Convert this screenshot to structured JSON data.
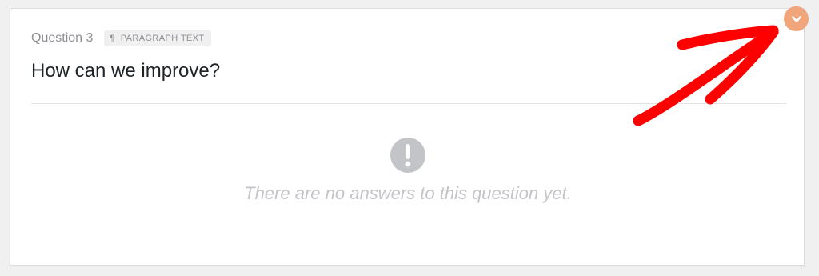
{
  "question": {
    "number_label": "Question 3",
    "type_icon": "¶",
    "type_label": "PARAGRAPH TEXT",
    "title": "How can we improve?"
  },
  "empty_state": {
    "icon": "exclamation-circle-icon",
    "message": "There are no answers to this question yet."
  },
  "toggle": {
    "icon": "chevron-down-icon",
    "color": "#f0a57a"
  },
  "annotation": {
    "color": "#ff0000"
  }
}
